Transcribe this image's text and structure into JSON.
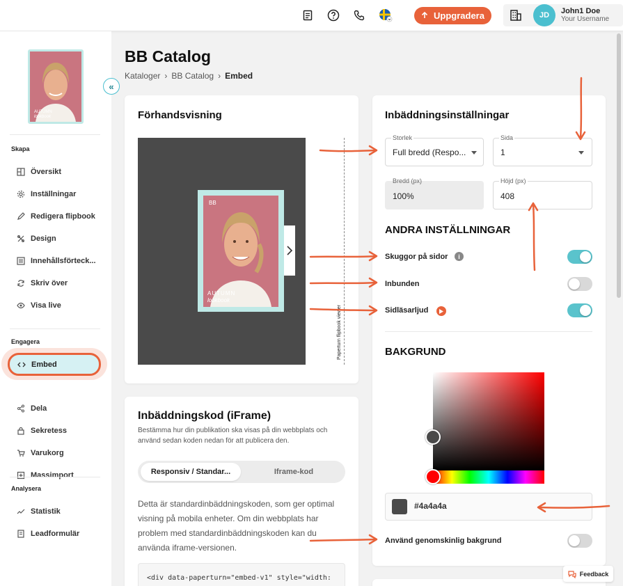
{
  "topbar": {
    "upgrade_label": "Uppgradera",
    "avatar_initials": "JD",
    "user_name": "John1 Doe",
    "user_sub": "Your Username"
  },
  "sidebar": {
    "cover_text_1": "AUTUMN",
    "cover_text_2": "lookbook",
    "sections": {
      "create": "Skapa",
      "engage": "Engagera",
      "analyze": "Analysera"
    },
    "create_items": [
      "Översikt",
      "Inställningar",
      "Redigera flipbook",
      "Design",
      "Innehållsförteck...",
      "Skriv över",
      "Visa live"
    ],
    "engage_items": [
      "Embed",
      "Dela",
      "Sekretess",
      "Varukorg",
      "Massimport"
    ],
    "analyze_items": [
      "Statistik",
      "Leadformulär"
    ]
  },
  "main": {
    "title": "BB Catalog",
    "breadcrumb": [
      "Kataloger",
      "BB Catalog",
      "Embed"
    ],
    "preview_title": "Förhandsvisning",
    "watermark": "Paperturn flipbook viewer",
    "embed_title": "Inbäddningskod (iFrame)",
    "embed_desc": "Bestämma hur din publikation ska visas på din webbplats och använd sedan koden nedan för att publicera den.",
    "seg_left": "Responsiv / Standar...",
    "seg_right": "Iframe-kod",
    "std_text": "Detta är standardinbäddningskoden, som ger optimal visning på mobila enheter. Om din webbplats har problem med standardinbäddningskoden kan du använda iframe-versionen.",
    "code": "<div data-paperturn=\"embed-v1\" style=\"width:"
  },
  "settings": {
    "title": "Inbäddningsinställningar",
    "size_label": "Storlek",
    "size_value": "Full bredd (Respo...",
    "page_label": "Sida",
    "page_value": "1",
    "width_label": "Bredd (px)",
    "width_value": "100%",
    "height_label": "Höjd (px)",
    "height_value": "408",
    "other_title": "ANDRA INSTÄLLNINGAR",
    "shadows_label": "Skuggor på sidor",
    "bound_label": "Inbunden",
    "sound_label": "Sidläsarljud",
    "bg_title": "BAKGRUND",
    "hex_value": "#4a4a4a",
    "transparent_label": "Använd genomskinlig bakgrund",
    "toggles": {
      "shadows": true,
      "bound": false,
      "sound": true,
      "transparent": false
    }
  },
  "feedback_label": "Feedback",
  "colors": {
    "accent": "#e8623a",
    "teal": "#5ac3cc",
    "swatch": "#4a4a4a"
  }
}
